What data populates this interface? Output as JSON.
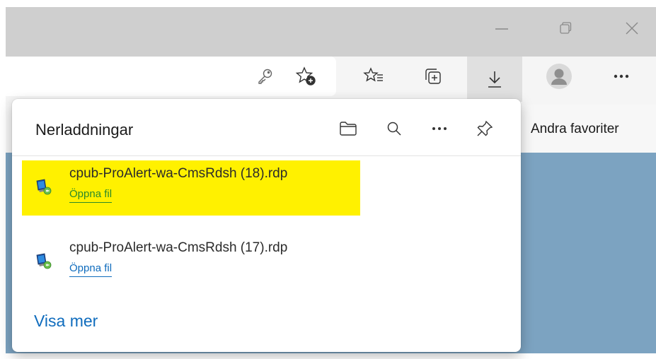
{
  "window": {
    "minimize_icon": "minimize-icon",
    "restore_icon": "restore-icon",
    "close_icon": "close-icon"
  },
  "toolbar": {
    "icons": [
      "key-icon",
      "add-favorite-icon",
      "favorites-icon",
      "collections-icon",
      "downloads-icon",
      "profile-icon",
      "more-icon"
    ]
  },
  "favorites_bar": {
    "other_favorites": "Andra favoriter"
  },
  "downloads_panel": {
    "title": "Nerladdningar",
    "header_icons": [
      "folder-icon",
      "search-icon",
      "more-icon",
      "pin-icon"
    ],
    "items": [
      {
        "name": "cpub-ProAlert-wa-CmsRdsh (18).rdp",
        "action": "Öppna fil",
        "highlighted": true
      },
      {
        "name": "cpub-ProAlert-wa-CmsRdsh (17).rdp",
        "action": "Öppna fil",
        "highlighted": false
      }
    ],
    "show_more": "Visa mer"
  },
  "colors": {
    "highlight": "#fff100",
    "link": "#0f6cbd",
    "link_highlighted": "#2a8a2a",
    "page_background": "#7ca3c1"
  }
}
